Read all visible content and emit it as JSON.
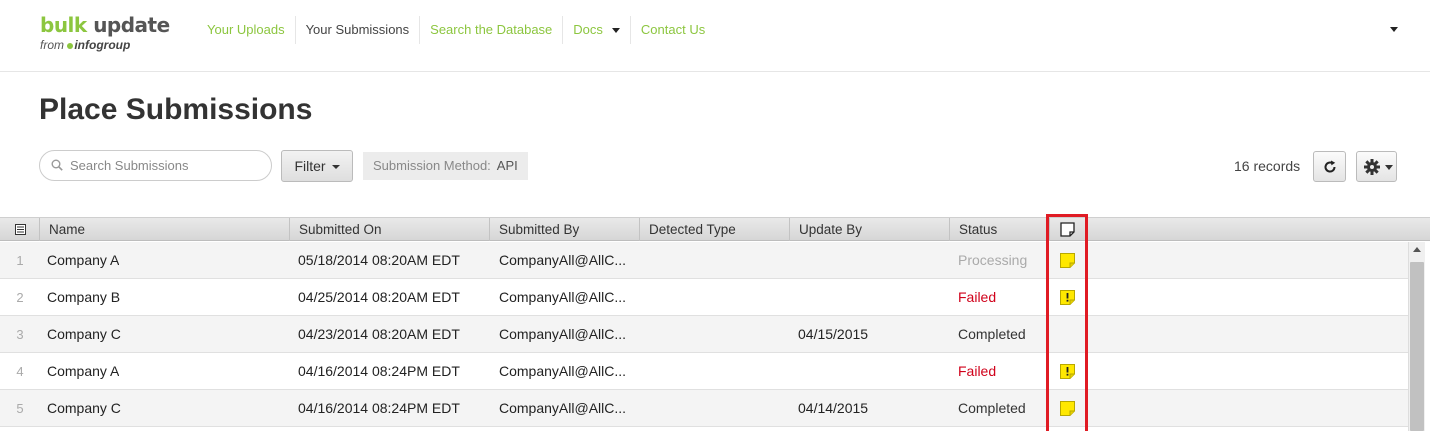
{
  "brand": {
    "title_prefix": "bulk ",
    "title_suffix": "update",
    "sub_from": "from",
    "sub_brand": "infogroup"
  },
  "nav": {
    "items": [
      {
        "label": "Your Uploads"
      },
      {
        "label": "Your Submissions"
      },
      {
        "label": "Search the Database"
      },
      {
        "label": "Docs"
      },
      {
        "label": "Contact Us"
      }
    ],
    "active": "Your Submissions"
  },
  "page": {
    "title": "Place Submissions"
  },
  "toolbar": {
    "search_placeholder": "Search Submissions",
    "search_value": "",
    "filter_label": "Filter",
    "chip_label": "Submission Method:",
    "chip_value": "API",
    "records": "16 records"
  },
  "grid": {
    "columns": [
      {
        "label": ""
      },
      {
        "label": "Name"
      },
      {
        "label": "Submitted On"
      },
      {
        "label": "Submitted By"
      },
      {
        "label": "Detected Type"
      },
      {
        "label": "Update By"
      },
      {
        "label": "Status"
      },
      {
        "label": ""
      }
    ],
    "rows": [
      {
        "num": "1",
        "name": "Company A",
        "submitted_on": "05/18/2014 08:20AM EDT",
        "submitted_by": "CompanyAll@AllC...",
        "detected_type": "",
        "update_by": "",
        "status": "Processing",
        "note": "note"
      },
      {
        "num": "2",
        "name": "Company B",
        "submitted_on": "04/25/2014 08:20AM EDT",
        "submitted_by": "CompanyAll@AllC...",
        "detected_type": "",
        "update_by": "",
        "status": "Failed",
        "note": "warning"
      },
      {
        "num": "3",
        "name": "Company C",
        "submitted_on": "04/23/2014 08:20AM EDT",
        "submitted_by": "CompanyAll@AllC...",
        "detected_type": "",
        "update_by": "04/15/2015",
        "status": "Completed",
        "note": ""
      },
      {
        "num": "4",
        "name": "Company A",
        "submitted_on": "04/16/2014 08:24PM EDT",
        "submitted_by": "CompanyAll@AllC...",
        "detected_type": "",
        "update_by": "",
        "status": "Failed",
        "note": "warning"
      },
      {
        "num": "5",
        "name": "Company C",
        "submitted_on": "04/16/2014 08:24PM EDT",
        "submitted_by": "CompanyAll@AllC...",
        "detected_type": "",
        "update_by": "04/14/2015",
        "status": "Completed",
        "note": "note"
      }
    ]
  },
  "colors": {
    "brand_green": "#8cc63f",
    "failed_red": "#d0021b",
    "highlight_red": "#e01b24",
    "note_yellow": "#ffe800"
  },
  "icons": {
    "search": "search-icon",
    "refresh": "refresh-icon",
    "settings": "gear-icon",
    "note": "sticky-note-icon",
    "warning_note": "warning-note-icon",
    "columns_menu": "column-menu-icon"
  }
}
